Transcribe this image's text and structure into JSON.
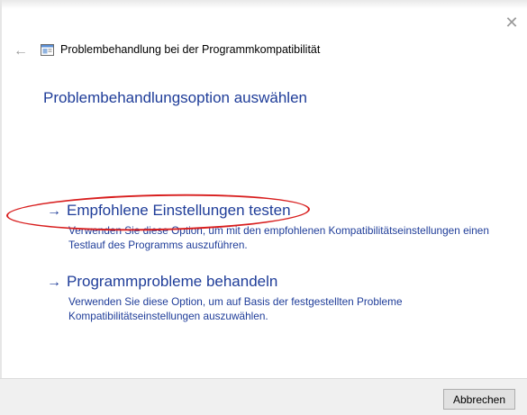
{
  "window": {
    "title": "Problembehandlung bei der Programmkompatibilität",
    "close_glyph": "✕",
    "back_glyph": "←"
  },
  "heading": "Problembehandlungsoption auswählen",
  "options": [
    {
      "arrow": "→",
      "title": "Empfohlene Einstellungen testen",
      "description": "Verwenden Sie diese Option, um mit den empfohlenen Kompatibilitätseinstellungen einen Testlauf des Programms auszuführen.",
      "highlighted": true
    },
    {
      "arrow": "→",
      "title": "Programmprobleme behandeln",
      "description": "Verwenden Sie diese Option, um auf Basis der festgestellten Probleme Kompatibilitätseinstellungen auszuwählen.",
      "highlighted": false
    }
  ],
  "footer": {
    "cancel_label": "Abbrechen"
  },
  "colors": {
    "link": "#1f3d99",
    "highlight_ellipse": "#d81e1e",
    "footer_bg": "#f0f0f0"
  },
  "icons": {
    "app": "program-compatibility-icon",
    "back": "back-arrow-icon",
    "close": "close-icon",
    "option_arrow": "right-arrow-icon"
  }
}
